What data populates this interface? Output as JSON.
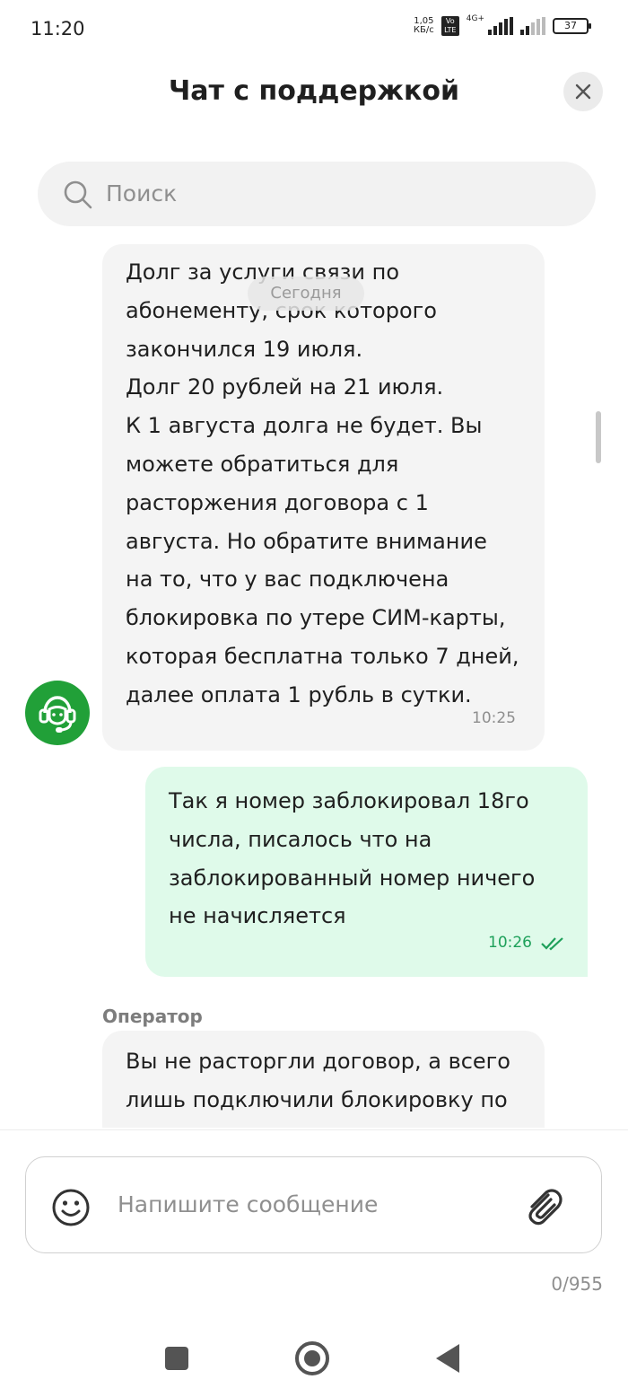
{
  "status_bar": {
    "time": "11:20",
    "net_speed_value": "1,05",
    "net_speed_unit": "КБ/с",
    "volte": "Vo LTE",
    "network": "4G+",
    "battery": "37"
  },
  "header": {
    "title": "Чат с поддержкой",
    "close_icon": "close-icon"
  },
  "search": {
    "placeholder": "Поиск"
  },
  "chat": {
    "date_separator": "Сегодня",
    "messages": [
      {
        "direction": "incoming",
        "text": "Долг за услуги связи по\nабонементу, срок которого\nзакончился 19 июля.\nДолг 20 рублей на 21 июля.\nК 1 августа долга не будет. Вы\nможете обратиться для\nрасторжения договора с 1\nавгуста. Но обратите внимание\nна то, что у вас подключена\nблокировка по утере СИМ-карты,\nкоторая бесплатна только 7 дней,\nдалее оплата 1 рубль в сутки.",
        "time": "10:25"
      },
      {
        "direction": "outgoing",
        "text": "Так я номер заблокировал 18го\nчисла, писалось что на\nзаблокированный номер ничего\nне начисляется",
        "time": "10:26",
        "status": "read"
      },
      {
        "direction": "incoming",
        "sender": "Оператор",
        "text": "Вы не расторгли договор, а всего\nлишь подключили блокировку по"
      }
    ]
  },
  "composer": {
    "placeholder": "Напишите сообщение",
    "counter": "0/955",
    "emoji_icon": "emoji-icon",
    "attach_icon": "paperclip-icon"
  },
  "nav_bar": {
    "buttons": [
      "recents",
      "home",
      "back"
    ]
  },
  "colors": {
    "accent": "#21a038",
    "outgoing_bubble": "#dffaea",
    "incoming_bubble": "#f4f4f4",
    "read_check": "#1ea05a"
  }
}
